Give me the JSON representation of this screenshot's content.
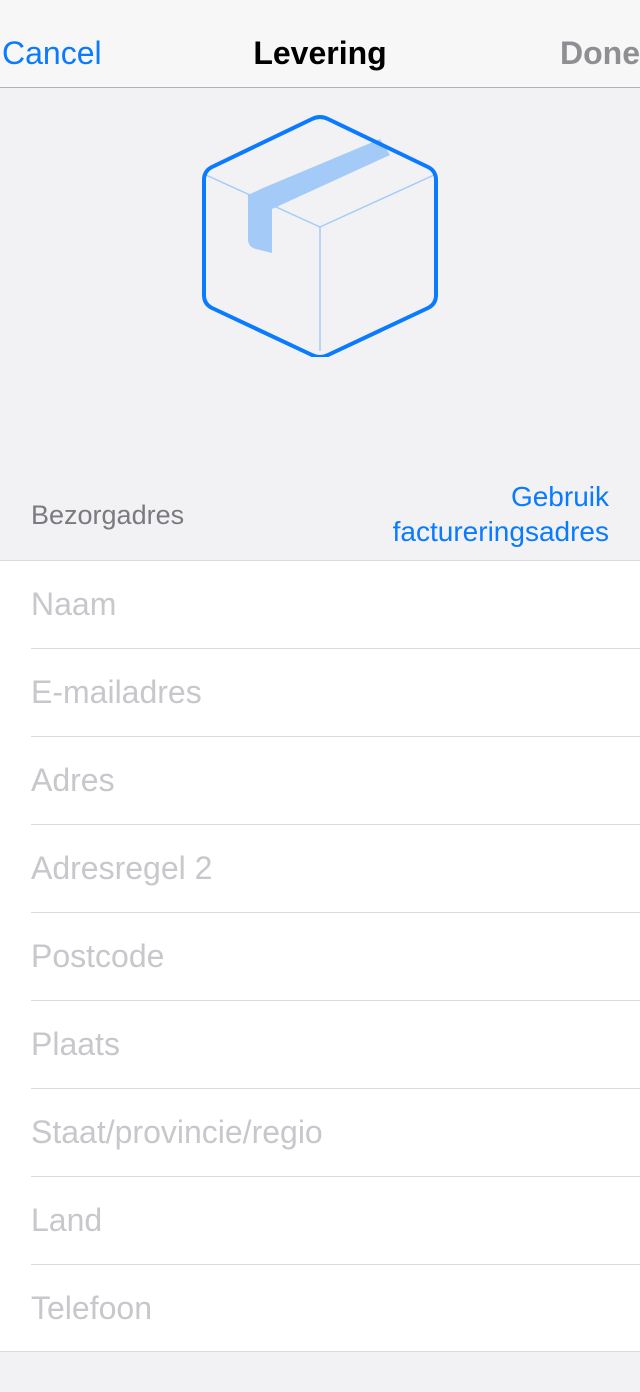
{
  "navbar": {
    "cancel_label": "Cancel",
    "title": "Levering",
    "done_label": "Done"
  },
  "hero": {
    "icon": "package-box-icon",
    "accent_color": "#0a7aff",
    "light_accent_color": "#a4cbf7"
  },
  "section": {
    "title": "Bezorgadres",
    "action_label": "Gebruik factureringsadres"
  },
  "fields": [
    {
      "name": "name-field",
      "placeholder": "Naam",
      "value": ""
    },
    {
      "name": "email-field",
      "placeholder": "E-mailadres",
      "value": ""
    },
    {
      "name": "address-field",
      "placeholder": "Adres",
      "value": ""
    },
    {
      "name": "address-line2-field",
      "placeholder": "Adresregel 2",
      "value": ""
    },
    {
      "name": "postal-code-field",
      "placeholder": "Postcode",
      "value": ""
    },
    {
      "name": "city-field",
      "placeholder": "Plaats",
      "value": ""
    },
    {
      "name": "state-field",
      "placeholder": "Staat/provincie/regio",
      "value": ""
    },
    {
      "name": "country-field",
      "placeholder": "Land",
      "value": ""
    },
    {
      "name": "phone-field",
      "placeholder": "Telefoon",
      "value": ""
    }
  ]
}
